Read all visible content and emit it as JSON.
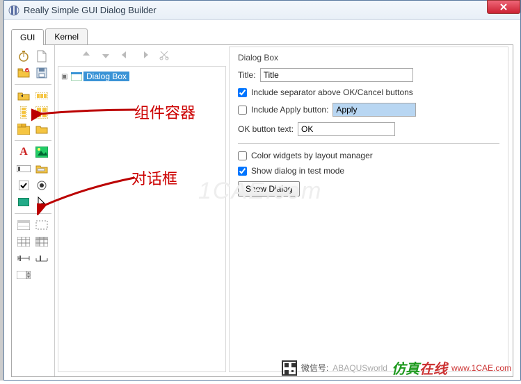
{
  "window": {
    "title": "Really Simple GUI Dialog Builder"
  },
  "tabs": [
    {
      "label": "GUI",
      "active": true
    },
    {
      "label": "Kernel",
      "active": false
    }
  ],
  "tree": {
    "root_label": "Dialog Box"
  },
  "properties": {
    "section_title": "Dialog Box",
    "title_label": "Title:",
    "title_value": "Title",
    "include_separator_label": "Include separator above OK/Cancel buttons",
    "include_separator_checked": true,
    "include_apply_label": "Include Apply button:",
    "include_apply_checked": false,
    "apply_button_text": "Apply",
    "ok_text_label": "OK button text:",
    "ok_text_value": "OK",
    "color_widgets_label": "Color widgets by layout manager",
    "color_widgets_checked": false,
    "show_in_test_mode_label": "Show dialog in test mode",
    "show_in_test_mode_checked": true,
    "show_dialog_button": "Show Dialog"
  },
  "annotations": {
    "label1": "组件容器",
    "label2": "对话框"
  },
  "watermark": {
    "center": "1CAE.com",
    "wechat_prefix": "微信号:",
    "wechat_id": "ABAQUSworld",
    "brand_cn": "仿真在线",
    "url": "www.1CAE.com"
  },
  "palette_icons": [
    [
      "timer-icon",
      "blank-page-icon"
    ],
    [
      "open-folder-icon",
      "save-icon"
    ],
    [
      "folder-back-icon",
      "row-strip-icon"
    ],
    [
      "column-strip-icon",
      "grid-boxes-icon"
    ],
    [
      "tab-layout-icon",
      "folder-plain-icon"
    ],
    [
      "text-a-icon",
      "image-icon"
    ],
    [
      "field-icon",
      "form-folder-icon"
    ],
    [
      "checkbox-icon",
      "radio-icon"
    ],
    [
      "color-swatch-icon",
      "cursor-icon"
    ],
    [
      "list-header-icon",
      "dashed-box-icon"
    ],
    [
      "table-icon",
      "table-filled-icon"
    ],
    [
      "slider-h-icon",
      "slider-v-icon"
    ],
    [
      "stepper-icon",
      ""
    ]
  ]
}
